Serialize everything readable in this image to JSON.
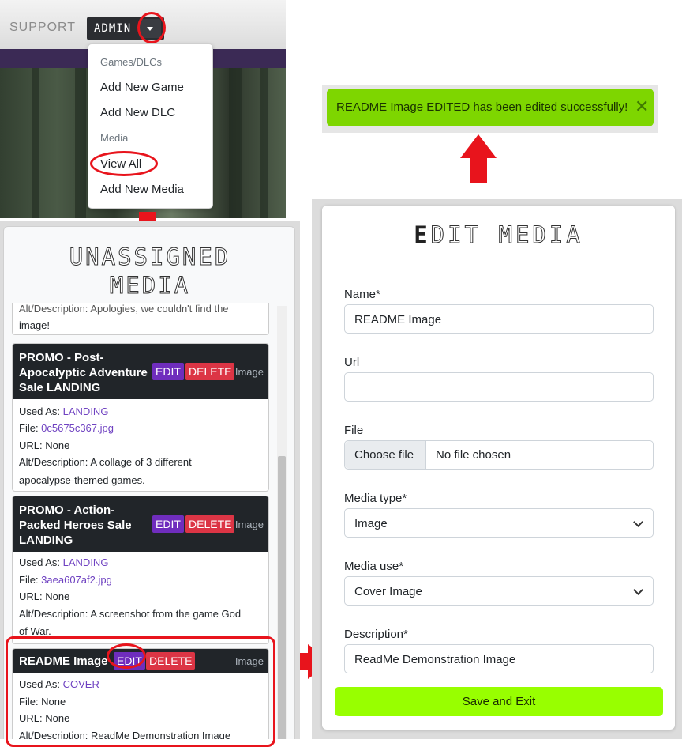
{
  "navbar": {
    "support_label": "SUPPORT",
    "admin_label": "ADMIN"
  },
  "dropdown": {
    "header_games": "Games/DLCs",
    "add_game": "Add New Game",
    "add_dlc": "Add New DLC",
    "header_media": "Media",
    "view_all": "View All",
    "add_media": "Add New Media"
  },
  "toast": {
    "message": "README Image EDITED has been edited successfully!",
    "close_glyph": "✕"
  },
  "unassigned": {
    "title_line1": "UNASSIGNED",
    "title_line2": "MEDIA",
    "partial_card": {
      "desc_tail_line1": "Alt/Description: Apologies, we couldn't find the",
      "desc_tail_line2": "image!"
    },
    "cards": [
      {
        "title_lines": [
          "PROMO - Post-",
          "Apocalyptic Adventure",
          "Sale LANDING"
        ],
        "edit_label": "EDIT",
        "delete_label": "DELETE",
        "type": "Image",
        "used_as_label": "Used As: ",
        "used_as": "LANDING",
        "file_label": "File: ",
        "file": "0c5675c367.jpg",
        "url_line": "URL: None",
        "desc_line1": "Alt/Description: A collage of 3 different",
        "desc_line2": "apocalypse-themed games."
      },
      {
        "title_lines": [
          "PROMO - Action-",
          "Packed Heroes Sale",
          "LANDING"
        ],
        "edit_label": "EDIT",
        "delete_label": "DELETE",
        "type": "Image",
        "used_as_label": "Used As: ",
        "used_as": "LANDING",
        "file_label": "File: ",
        "file": "3aea607af2.jpg",
        "url_line": "URL: None",
        "desc_line1": "Alt/Description: A screenshot from the game God",
        "desc_line2": "of War."
      },
      {
        "title_lines": [
          "README Image"
        ],
        "edit_label": "EDIT",
        "delete_label": "DELETE",
        "type": "Image",
        "used_as_label": "Used As: ",
        "used_as": "COVER",
        "file_line": "File: None",
        "url_line": "URL: None",
        "desc_line1": "Alt/Description: ReadMe Demonstration Image"
      }
    ]
  },
  "edit_form": {
    "title_first": "E",
    "title_rest": "DIT MEDIA",
    "name_label": "Name*",
    "name_value": "README Image",
    "url_label": "Url",
    "url_value": "",
    "file_label": "File",
    "file_button": "Choose file",
    "file_status": "No file chosen",
    "media_type_label": "Media type*",
    "media_type_value": "Image",
    "media_use_label": "Media use*",
    "media_use_value": "Cover Image",
    "description_label": "Description*",
    "description_value": "ReadMe Demonstration Image",
    "save_label": "Save and Exit"
  },
  "colors": {
    "annotation_red": "#e8141c",
    "edit_purple": "#6f2dbd",
    "delete_red": "#dc3545",
    "toast_green": "#7ed600",
    "save_green": "#98ff00",
    "card_header": "#212529"
  }
}
